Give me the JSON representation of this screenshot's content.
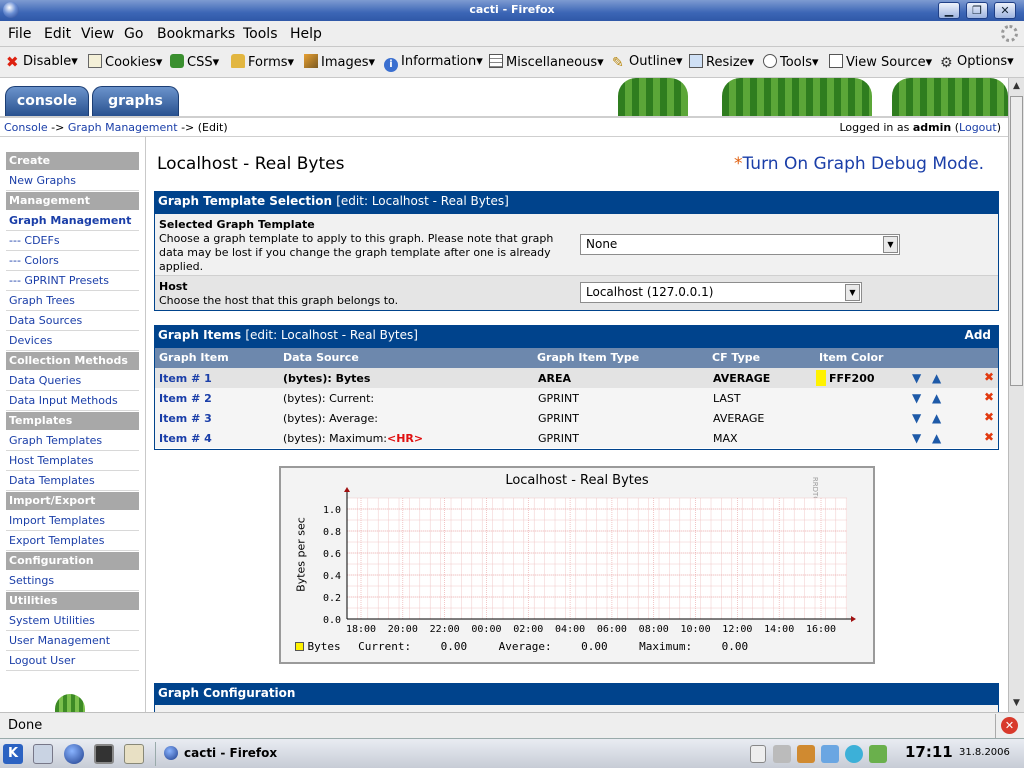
{
  "window": {
    "title": "cacti - Firefox"
  },
  "menubar": [
    "File",
    "Edit",
    "View",
    "Go",
    "Bookmarks",
    "Tools",
    "Help"
  ],
  "toolbar": [
    "Disable▾",
    "Cookies▾",
    "CSS▾",
    "Forms▾",
    "Images▾",
    "Information▾",
    "Miscellaneous▾",
    "Outline▾",
    "Resize▾",
    "Tools▾",
    "View Source▾",
    "Options▾"
  ],
  "tabs": {
    "console": "console",
    "graphs": "graphs"
  },
  "breadcrumb": {
    "console": "Console",
    "sep1": "->",
    "graph_mgmt": "Graph Management",
    "sep2": "->",
    "current": "(Edit)"
  },
  "login": {
    "prefix": "Logged in as",
    "user": "admin",
    "logout": "Logout"
  },
  "sidebar": {
    "create": "Create",
    "new_graphs": "New Graphs",
    "management": "Management",
    "graph_management": "Graph Management",
    "cdefs": "--- CDEFs",
    "colors": "--- Colors",
    "gprint": "--- GPRINT Presets",
    "graph_trees": "Graph Trees",
    "data_sources": "Data Sources",
    "devices": "Devices",
    "collection": "Collection Methods",
    "data_queries": "Data Queries",
    "data_input": "Data Input Methods",
    "templates": "Templates",
    "graph_templates": "Graph Templates",
    "host_templates": "Host Templates",
    "data_templates": "Data Templates",
    "import_export": "Import/Export",
    "import_templates": "Import Templates",
    "export_templates": "Export Templates",
    "configuration": "Configuration",
    "settings": "Settings",
    "utilities": "Utilities",
    "system_utilities": "System Utilities",
    "user_management": "User Management",
    "logout_user": "Logout User"
  },
  "main": {
    "title": "Localhost - Real Bytes",
    "debug_star": "*",
    "debug_link": "Turn On Graph Debug Mode.",
    "template_section": {
      "title": "Graph Template Selection",
      "edit": "[edit: Localhost - Real Bytes]",
      "selected_label": "Selected Graph Template",
      "selected_desc": "Choose a graph template to apply to this graph. Please note that graph data may be lost if you change the graph template after one is already applied.",
      "selected_value": "None",
      "host_label": "Host",
      "host_desc": "Choose the host that this graph belongs to.",
      "host_value": "Localhost (127.0.0.1)"
    },
    "items_section": {
      "title": "Graph Items",
      "edit": "[edit: Localhost - Real Bytes]",
      "add": "Add",
      "columns": [
        "Graph Item",
        "Data Source",
        "Graph Item Type",
        "CF Type",
        "Item Color"
      ],
      "rows": [
        {
          "item": "Item # 1",
          "source": "(bytes): Bytes",
          "hr": "",
          "type": "AREA",
          "cf": "AVERAGE",
          "color": "FFF200",
          "swatch": "#FFF200"
        },
        {
          "item": "Item # 2",
          "source": "(bytes): Current:",
          "hr": "",
          "type": "GPRINT",
          "cf": "LAST",
          "color": "",
          "swatch": ""
        },
        {
          "item": "Item # 3",
          "source": "(bytes): Average:",
          "hr": "",
          "type": "GPRINT",
          "cf": "AVERAGE",
          "color": "",
          "swatch": ""
        },
        {
          "item": "Item # 4",
          "source": "(bytes): Maximum:",
          "hr": "<HR>",
          "type": "GPRINT",
          "cf": "MAX",
          "color": "",
          "swatch": ""
        }
      ]
    },
    "config_section": {
      "title": "Graph Configuration"
    }
  },
  "chart_data": {
    "type": "area",
    "title": "Localhost - Real Bytes",
    "ylabel": "Bytes per sec",
    "xlabel": "",
    "watermark": "RRDTOOL / TOBI OETIKER",
    "x_ticks": [
      "18:00",
      "20:00",
      "22:00",
      "00:00",
      "02:00",
      "04:00",
      "06:00",
      "08:00",
      "10:00",
      "12:00",
      "14:00",
      "16:00"
    ],
    "y_ticks": [
      "0.0",
      "0.2",
      "0.4",
      "0.6",
      "0.8",
      "1.0"
    ],
    "ylim": [
      0,
      1.1
    ],
    "grid": true,
    "series": [
      {
        "name": "Bytes",
        "color": "#FFF200",
        "values": []
      }
    ],
    "legend": {
      "label": "Bytes",
      "current_label": "Current:",
      "current": "0.00",
      "average_label": "Average:",
      "average": "0.00",
      "maximum_label": "Maximum:",
      "maximum": "0.00"
    }
  },
  "statusbar": {
    "text": "Done"
  },
  "taskbar": {
    "window": "cacti - Firefox",
    "time": "17:11",
    "date": "31.8.2006"
  }
}
